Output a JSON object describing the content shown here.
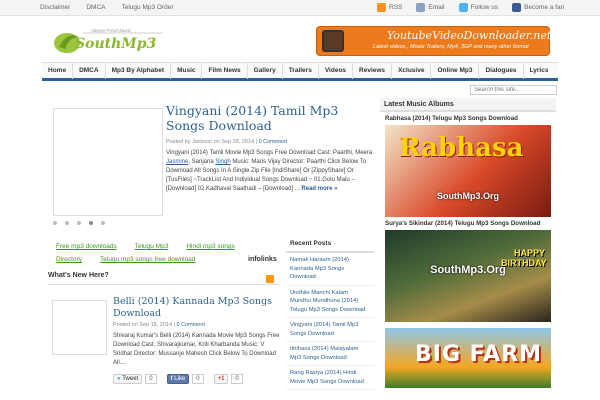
{
  "topbar": {
    "links": [
      "Disclaimer",
      "DMCA",
      "Telugu Mp3 Order"
    ],
    "rss": "RSS",
    "email": "Email",
    "follow": "Follow us",
    "fan": "Become a fan"
  },
  "logo": {
    "tagline": "Always Fresh Music",
    "main": "SouthMp3"
  },
  "banner": {
    "title": "YoutubeVideoDownloader.net",
    "subtitle": "Latest videos , Movie Trailers, Mp4, 3GP and many other format"
  },
  "nav": [
    "Home",
    "DMCA",
    "Mp3 By Alphabet",
    "Music",
    "Film News",
    "Gallery",
    "Trailers",
    "Videos",
    "Reviews",
    "Xclusive",
    "Online Mp3",
    "Dialogues",
    "Lyrics"
  ],
  "search": {
    "placeholder": "Search this site..."
  },
  "featured": {
    "title": "Vingyani (2014) Tamil Mp3 Songs Download",
    "meta_prefix": "Posted by Jackson on Sep 28, 2014",
    "comments": "0 Comment",
    "body_a": "Vingyani (2014) Tamil Movie Mp3 Songs Free Download Cast: Paarthi, Meera ",
    "body_link1": "Jasmine",
    "body_b": ", Sanjana ",
    "body_link2": "Singh",
    "body_c": " Music: Maris Vijay Director: Paarthi Click Below To Download All Songs In A Single Zip File [IndiShare] Or [ZippyShare] Or [TusFiles] ~TrackList And Individual Songs Download:~ 01.Golu Malu – [Download] 02.Kadhaval Saathadi – [Download] ... ",
    "read_more": "Read more »"
  },
  "adlinks": {
    "row1": [
      "Free mp3 downloads",
      "Telugu Mp3",
      "Hindi mp3 songs"
    ],
    "row2": [
      "Directory",
      "Telugu mp3 songs free download"
    ],
    "infolinks": "infolinks"
  },
  "whatsnew": {
    "heading": "What's New Here?"
  },
  "post2": {
    "title": "Belli (2014) Kannada Mp3 Songs Download",
    "meta": "Posted on Sep 18, 2014",
    "comments": "0 Comment",
    "body": "Shivaraj Kumar's Belli (2014) Kannada Movie Mp3 Songs Free Download Cast: Shivarajkumar, Kriti Kharbanda Music: V Sridhar Director: Mussanje Mahesh Click Below To Download All....",
    "tweet": "Tweet",
    "tweet_count": "0",
    "like": "Like",
    "like_count": "0",
    "gplus": "+1",
    "gplus_count": "0"
  },
  "recent": {
    "heading": "Recent Posts",
    "items": [
      "Namak Haraam (2014) Kannada Mp3 Songs Download",
      "Undhile Manchi Kalam Mundhu Mundhuna (2014) Telugu Mp3 Songs Download",
      "Vingyani (2014) Tamil Mp3 Songs Download",
      "Ithihasa (2014) Malayalam Mp3 Songs Download",
      "Rang Rasiya (2014) Hindi Movie Mp3 Songs Download"
    ]
  },
  "sidebar": {
    "heading": "Latest Music Albums",
    "albums": [
      {
        "title": "Rabhasa (2014) Telugu Mp3 Songs Download",
        "watermark": "SouthMp3.Org",
        "art_text": "Rabhasa"
      },
      {
        "title": "Surya's Sikindar (2014) Telugu Mp3 Songs Download",
        "watermark": "SouthMp3.Org",
        "art_text": "HAPPY BIRTHDAY"
      },
      {
        "title": "",
        "watermark": "",
        "art_text": "BIG FARM"
      }
    ]
  },
  "colors": {
    "nav_border": "#2c5f93",
    "link": "#2c5f93",
    "ad_link": "#3a9a1a",
    "banner": "#ee7a1e"
  }
}
